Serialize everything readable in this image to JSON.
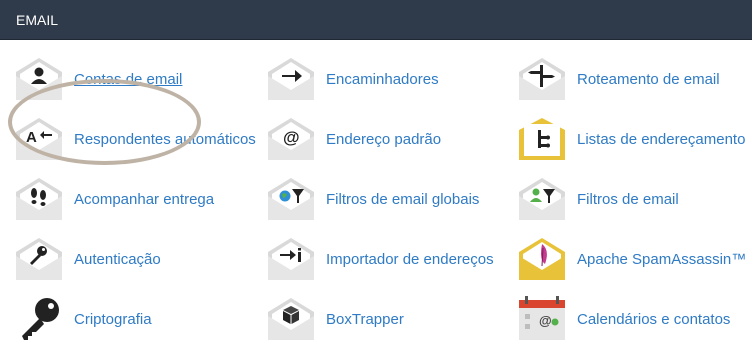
{
  "section": {
    "title": "EMAIL"
  },
  "items": [
    {
      "label": "Contas de email",
      "icon": "user-icon"
    },
    {
      "label": "Encaminhadores",
      "icon": "arrow-right-icon"
    },
    {
      "label": "Roteamento de email",
      "icon": "signpost-icon"
    },
    {
      "label": "Respondentes automáticos",
      "icon": "autoreply-icon"
    },
    {
      "label": "Endereço padrão",
      "icon": "at-sign-icon"
    },
    {
      "label": "Listas de endereçamento",
      "icon": "mailing-list-icon"
    },
    {
      "label": "Acompanhar entrega",
      "icon": "footprints-icon"
    },
    {
      "label": "Filtros de email globais",
      "icon": "globe-filter-icon"
    },
    {
      "label": "Filtros de email",
      "icon": "user-filter-icon"
    },
    {
      "label": "Autenticação",
      "icon": "key-icon"
    },
    {
      "label": "Importador de endereços",
      "icon": "import-icon"
    },
    {
      "label": "Apache SpamAssassin™",
      "icon": "feather-icon"
    },
    {
      "label": "Criptografia",
      "icon": "large-key-icon"
    },
    {
      "label": "BoxTrapper",
      "icon": "box-icon"
    },
    {
      "label": "Calendários e contatos",
      "icon": "calendar-icon"
    }
  ],
  "colors": {
    "header_bg": "#2f3a4a",
    "link": "#2f7bc5",
    "highlight_ring": "#bfb3a6",
    "envelope": "#d9d9d9",
    "yellow_envelope": "#e8c33a"
  }
}
